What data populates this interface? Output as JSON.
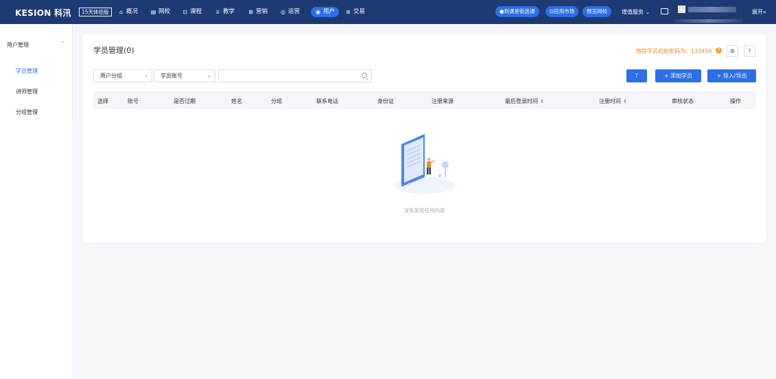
{
  "topbar": {
    "logo": "KESION 科汛",
    "trial_badge": "15天体验版",
    "nav": [
      {
        "label": "概况",
        "icon": "home-icon",
        "glyph": "⌂"
      },
      {
        "label": "网校",
        "icon": "school-icon",
        "glyph": "▤"
      },
      {
        "label": "课程",
        "icon": "course-icon",
        "glyph": "⊡"
      },
      {
        "label": "教学",
        "icon": "teaching-icon",
        "glyph": "♕"
      },
      {
        "label": "营销",
        "icon": "marketing-icon",
        "glyph": "⊞"
      },
      {
        "label": "运营",
        "icon": "operation-icon",
        "glyph": "◎"
      },
      {
        "label": "用户",
        "icon": "user-icon",
        "glyph": "◉"
      },
      {
        "label": "交易",
        "icon": "trade-icon",
        "glyph": "⊛"
      }
    ],
    "pills": [
      "到课堂街选课",
      "应用市场",
      "预览网校"
    ],
    "value_service": "增值服务",
    "expand": "展开«"
  },
  "sidebar": {
    "header": "用户管理",
    "items": [
      {
        "label": "学员管理"
      },
      {
        "label": "讲师管理"
      },
      {
        "label": "分组管理"
      }
    ]
  },
  "main": {
    "title": "学员管理(0)",
    "password_tip": "微信学员初始密码为：123456",
    "filters": {
      "group_select": "用户分组",
      "account_select": "学员账号",
      "search_placeholder": ""
    },
    "buttons": {
      "filter": "⊤",
      "add_student": "+ 添加学员",
      "import_export": "+ 导入/导出"
    },
    "columns": [
      "选择",
      "账号",
      "是否过期",
      "姓名",
      "分组",
      "联系电话",
      "身份证",
      "注册来源",
      "最后登录时间",
      "注册时间",
      "审核状态",
      "操作"
    ],
    "empty_text": "没有发现任何内容"
  },
  "colors": {
    "nav_bg": "#1d3a73",
    "accent": "#2c6fe6",
    "tip": "#f08a2b"
  }
}
